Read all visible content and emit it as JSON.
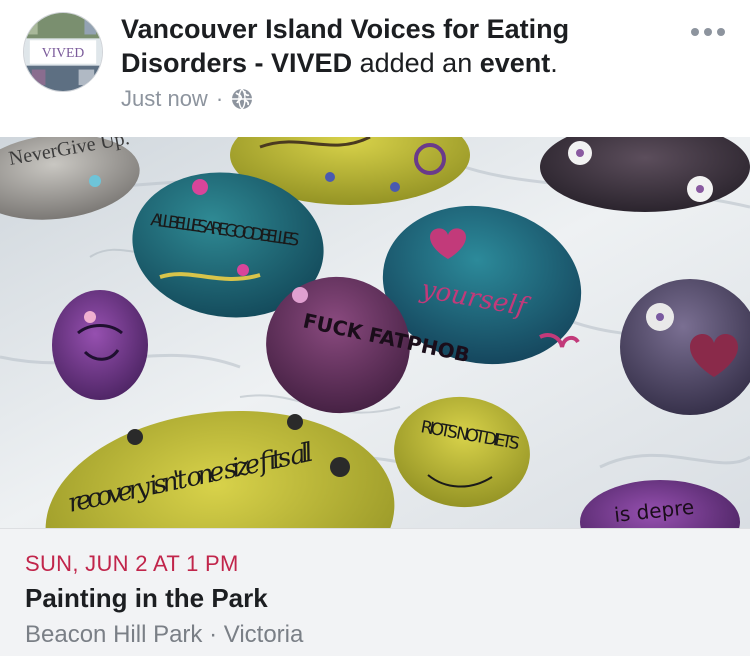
{
  "post": {
    "author": "Vancouver Island Voices for Eating Disorders - VIVED",
    "action_text": "added an",
    "action_object": "event",
    "action_end": ".",
    "timestamp": "Just now",
    "separator": "·",
    "privacy_icon": "globe-icon",
    "more_icon": "more-options-icon"
  },
  "avatar": {
    "logo_text": "VIVED"
  },
  "image": {
    "alt": "Painted rocks on a white sheet",
    "rock_texts": {
      "never_give_up": "NeverGive Up.",
      "bellies": "ALL BELLIES ARE GOOD BELLIES",
      "yourself": "yourself",
      "fatphob": "FUCK FATPHOB",
      "riots": "RIOTS NOT DIETS",
      "recovery": "recovery isn't one size fits all",
      "depre": "is depre"
    }
  },
  "event": {
    "date": "SUN, JUN 2 AT 1 PM",
    "title": "Painting in the Park",
    "location": "Beacon Hill Park · Victoria"
  },
  "colors": {
    "date_accent": "#c1254b",
    "meta_gray": "#8d949e",
    "info_bg": "#f2f3f5"
  }
}
